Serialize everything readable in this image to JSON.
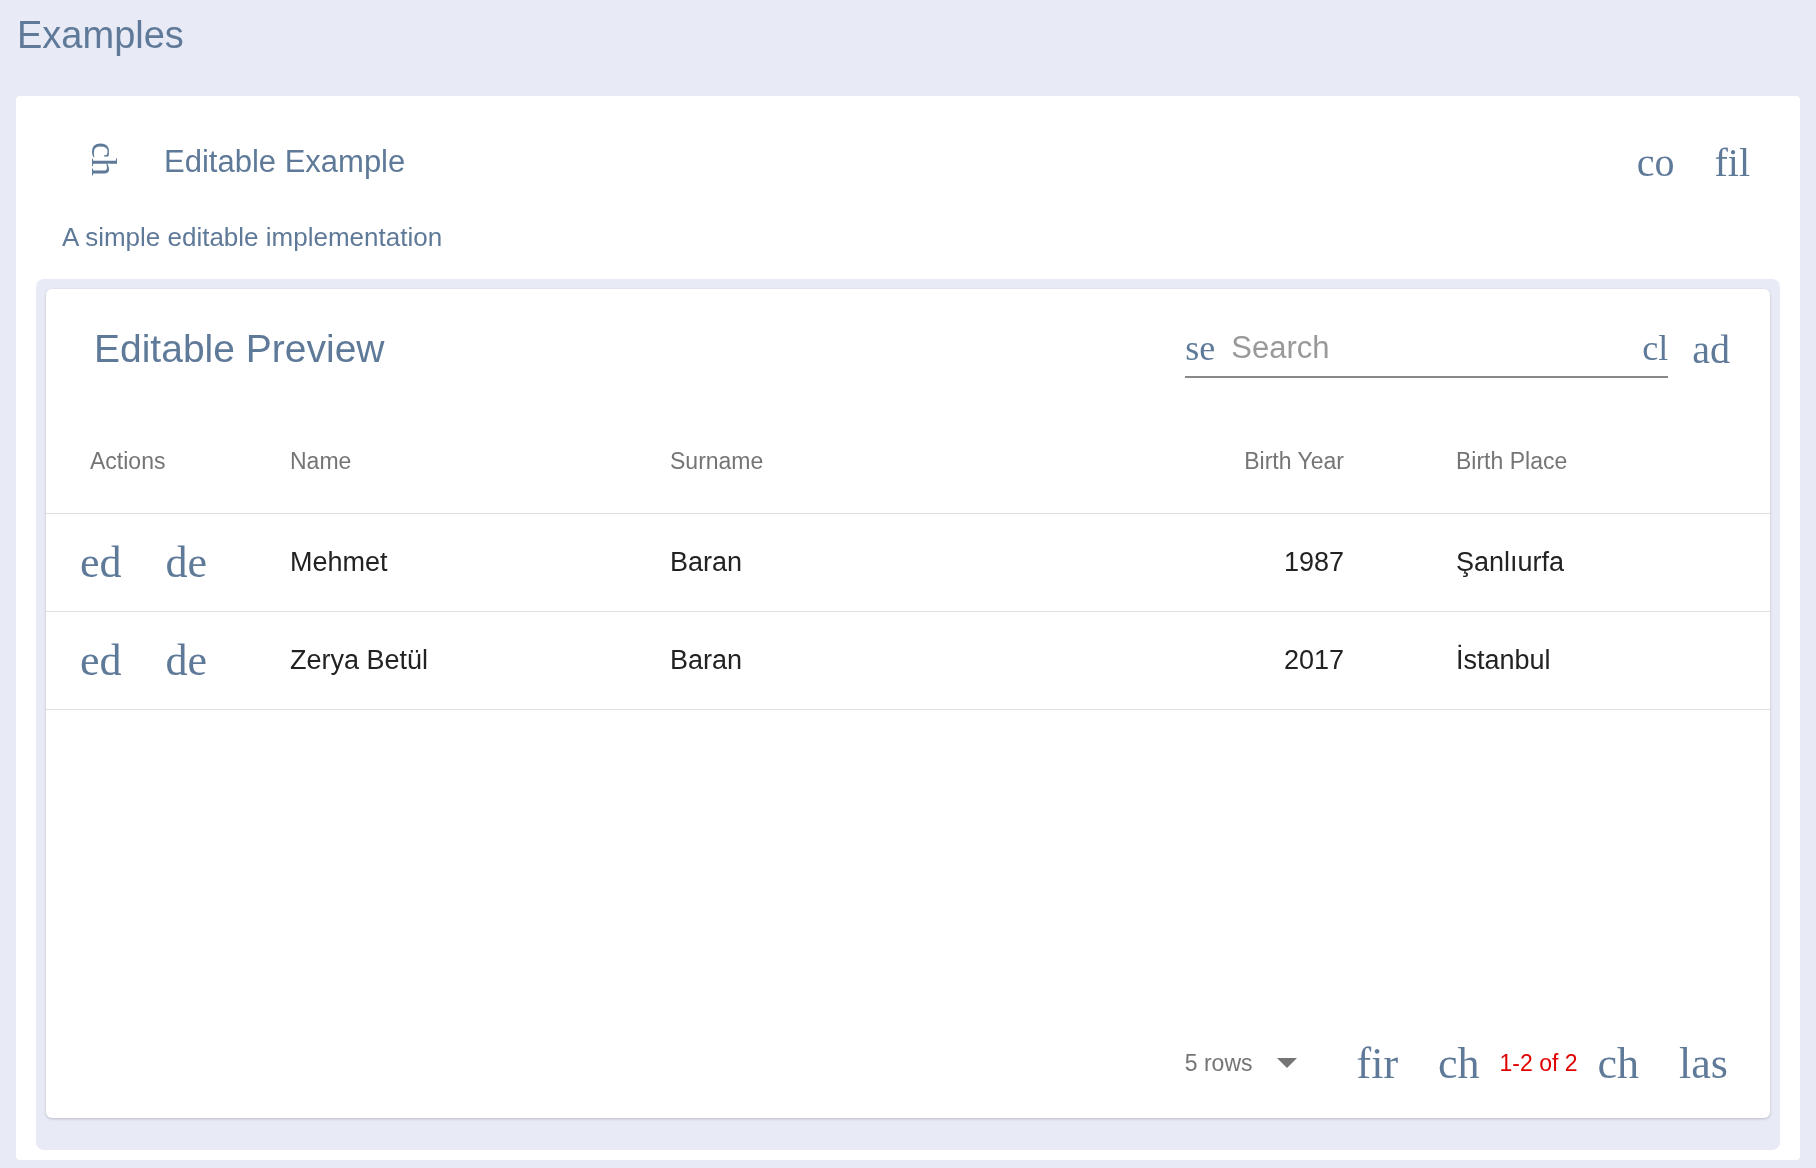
{
  "page_title": "Examples",
  "example": {
    "header_icon": "ch",
    "title": "Editable Example",
    "actions": [
      "co",
      "fil"
    ],
    "description": "A simple editable implementation"
  },
  "table": {
    "title": "Editable Preview",
    "search": {
      "icon": "se",
      "placeholder": "Search",
      "clear_icon": "cl"
    },
    "add_icon": "ad",
    "columns": [
      "Actions",
      "Name",
      "Surname",
      "Birth Year",
      "Birth Place"
    ],
    "rows": [
      {
        "cells": [
          {
            "kind": "icons",
            "icons": [
              "ed",
              "de"
            ]
          },
          {
            "kind": "text",
            "text": "Mehmet"
          },
          {
            "kind": "text",
            "text": "Baran"
          },
          {
            "kind": "text",
            "text": "1987"
          },
          {
            "kind": "text",
            "text": "Şanlıurfa"
          }
        ]
      },
      {
        "cells": [
          {
            "kind": "icons",
            "icons": [
              "ed",
              "de"
            ]
          },
          {
            "kind": "text",
            "text": "Zerya Betül"
          },
          {
            "kind": "text",
            "text": "Baran"
          },
          {
            "kind": "text",
            "text": "2017"
          },
          {
            "kind": "text",
            "text": "İstanbul"
          }
        ]
      }
    ],
    "pagination": {
      "page_size": "5 rows",
      "first": "fir",
      "prev": "ch",
      "range": "1-2 of 2",
      "next": "ch",
      "last": "las"
    }
  }
}
